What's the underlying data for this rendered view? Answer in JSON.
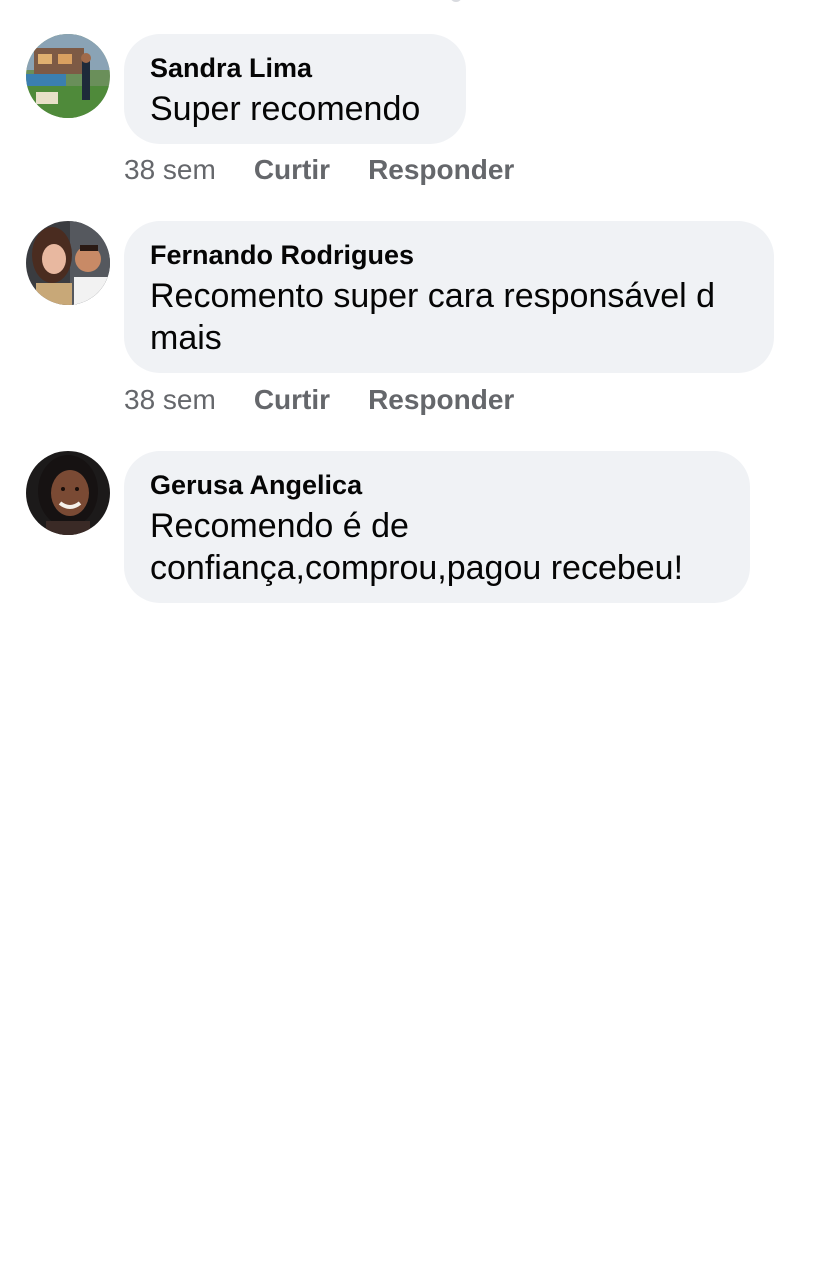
{
  "comments": [
    {
      "author": "Sandra Lima",
      "text": "Super recomendo",
      "time": "38 sem",
      "like_label": "Curtir",
      "reply_label": "Responder"
    },
    {
      "author": "Fernando Rodrigues",
      "text": "Recomento super cara responsável d mais",
      "time": "38 sem",
      "like_label": "Curtir",
      "reply_label": "Responder"
    },
    {
      "author": "Gerusa Angelica",
      "text": "Recomendo é de confiança,comprou,pagou recebeu!",
      "time": "",
      "like_label": "",
      "reply_label": ""
    }
  ],
  "colors": {
    "bubble_bg": "#f0f2f5",
    "meta_text": "#65676b",
    "primary_text": "#050505"
  }
}
